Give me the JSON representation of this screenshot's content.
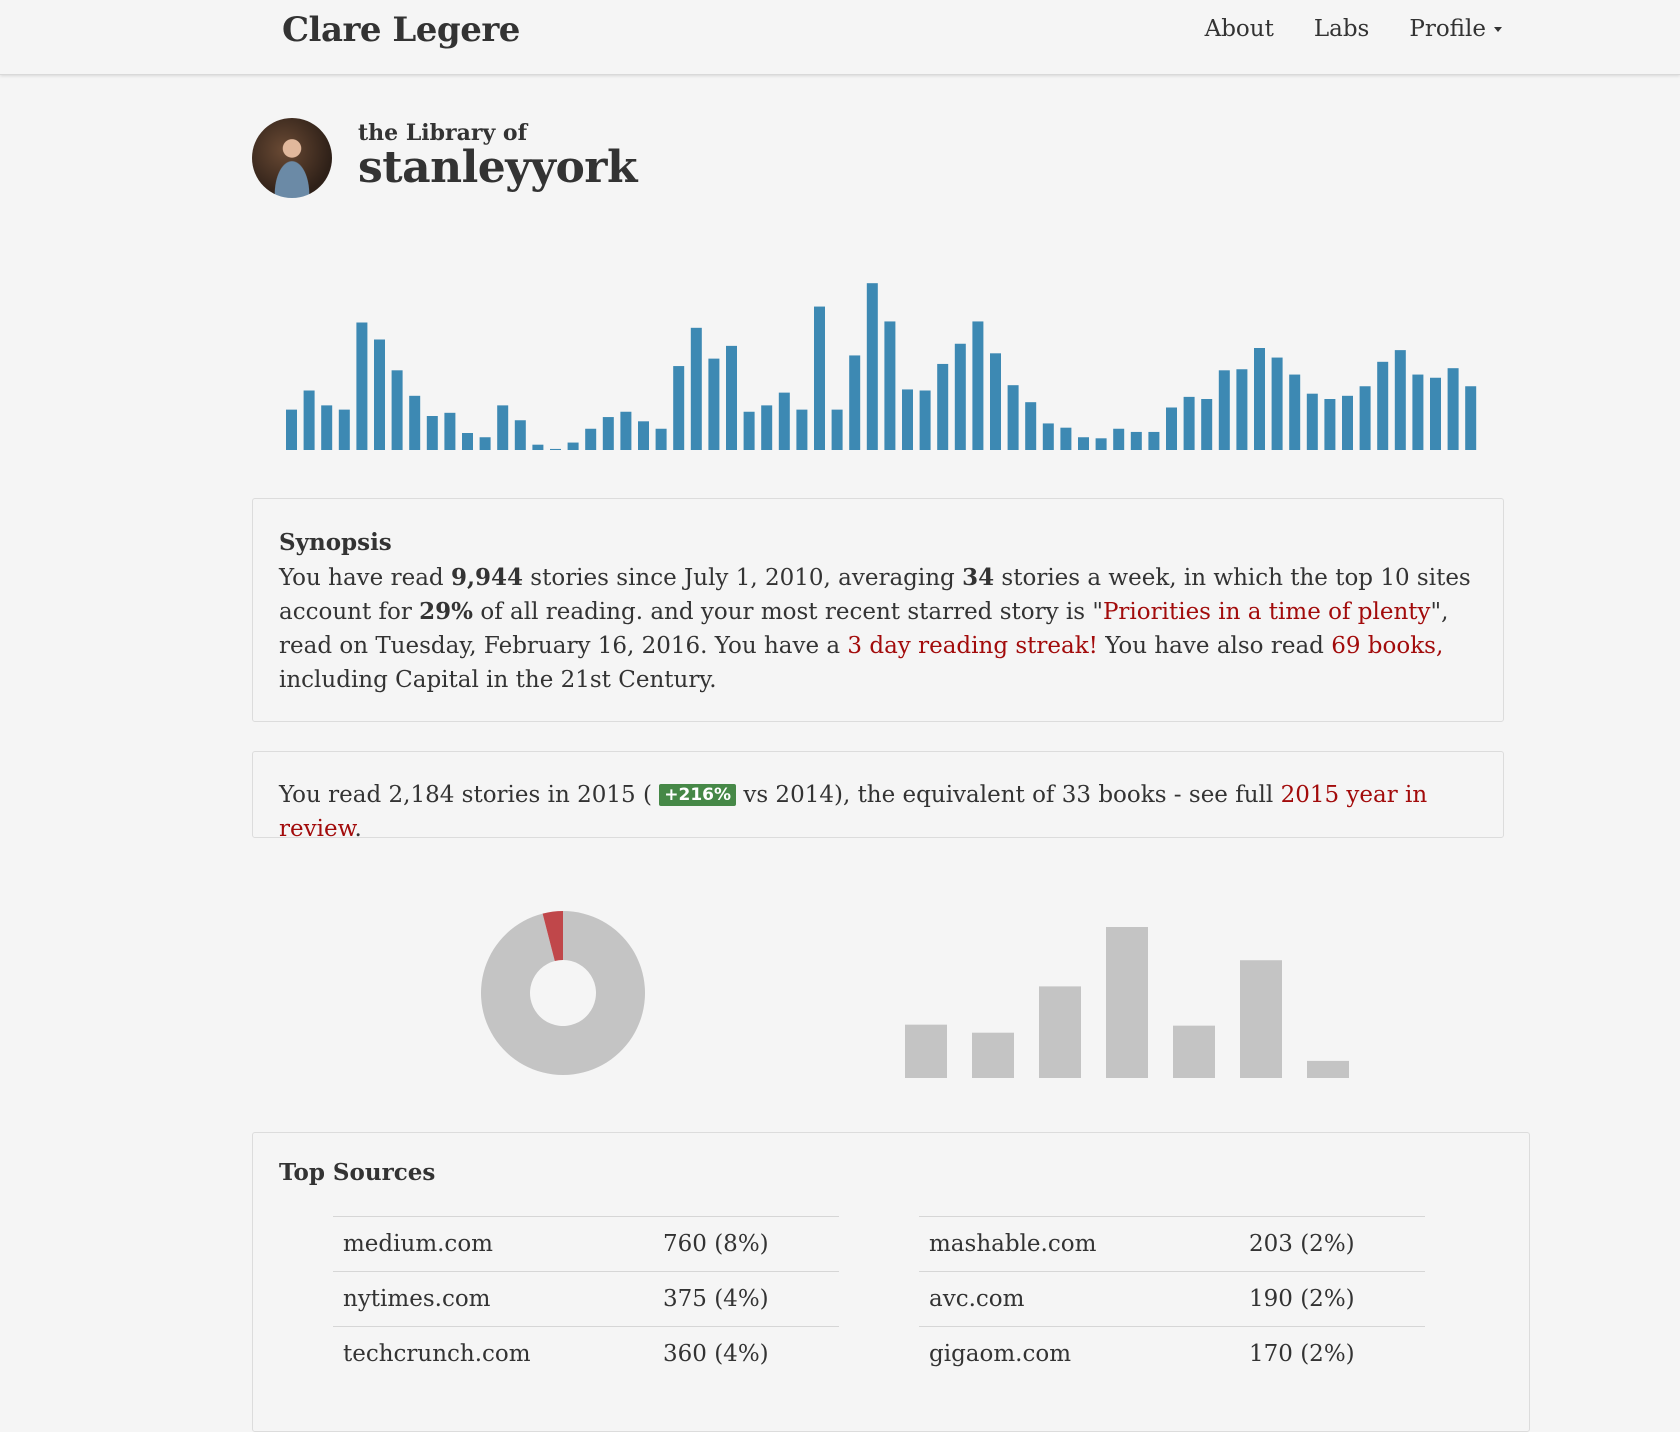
{
  "nav": {
    "brand": "Clare Legere",
    "links": [
      "About",
      "Labs",
      "Profile"
    ]
  },
  "profile": {
    "prefix": "the Library of",
    "username": "stanleyyork"
  },
  "colors": {
    "accent_bar": "#3d89b3",
    "link": "#a20b0b",
    "badge": "#468847",
    "donut_main": "#c4c4c4",
    "donut_slice": "#c0474a",
    "gray_bar": "#c4c4c4"
  },
  "synopsis": {
    "heading": "Synopsis",
    "t1": "You have read ",
    "stories": "9,944",
    "t2": " stories since July 1, 2010, averaging ",
    "per_week": "34",
    "t3": " stories a week, in which the top 10 sites account for ",
    "percent": "29%",
    "t4": " of all reading. and your most recent starred story is \"",
    "starred_story": "Priorities in a time of plenty",
    "t5": "\", read on Tuesday, February 16, 2016. You have a ",
    "streak": "3 day reading streak!",
    "t6": " You have also read ",
    "books": "69 books,",
    "t7": " including Capital in the 21st Century."
  },
  "year": {
    "t1": "You read 2,184 stories in 2015 ( ",
    "badge": "+216%",
    "t2": " vs 2014), the equivalent of 33 books - see full ",
    "link": "2015 year in review",
    "t3": "."
  },
  "chart_data": [
    {
      "type": "bar",
      "values": [
        38,
        56,
        42,
        38,
        120,
        104,
        75,
        51,
        32,
        35,
        16,
        12,
        42,
        28,
        5,
        1,
        7,
        20,
        31,
        36,
        27,
        20,
        79,
        115,
        86,
        98,
        36,
        42,
        54,
        38,
        135,
        38,
        89,
        157,
        121,
        57,
        56,
        81,
        100,
        121,
        91,
        61,
        45,
        25,
        21,
        12,
        11,
        20,
        17,
        17,
        40,
        50,
        48,
        75,
        76,
        96,
        87,
        71,
        53,
        48,
        51,
        60,
        83,
        94,
        71,
        68,
        77,
        60
      ],
      "title": "",
      "xlabel": "",
      "ylabel": ""
    },
    {
      "type": "pie",
      "labels": [],
      "values": [
        96,
        4
      ]
    },
    {
      "type": "bar",
      "values": [
        53,
        45,
        91,
        150,
        52,
        117,
        17
      ],
      "title": "",
      "xlabel": "",
      "ylabel": ""
    }
  ],
  "sources": {
    "heading": "Top Sources",
    "left": [
      {
        "site": "medium.com",
        "count": "760 (8%)"
      },
      {
        "site": "nytimes.com",
        "count": "375 (4%)"
      },
      {
        "site": "techcrunch.com",
        "count": "360 (4%)"
      }
    ],
    "right": [
      {
        "site": "mashable.com",
        "count": "203 (2%)"
      },
      {
        "site": "avc.com",
        "count": "190 (2%)"
      },
      {
        "site": "gigaom.com",
        "count": "170 (2%)"
      }
    ]
  }
}
